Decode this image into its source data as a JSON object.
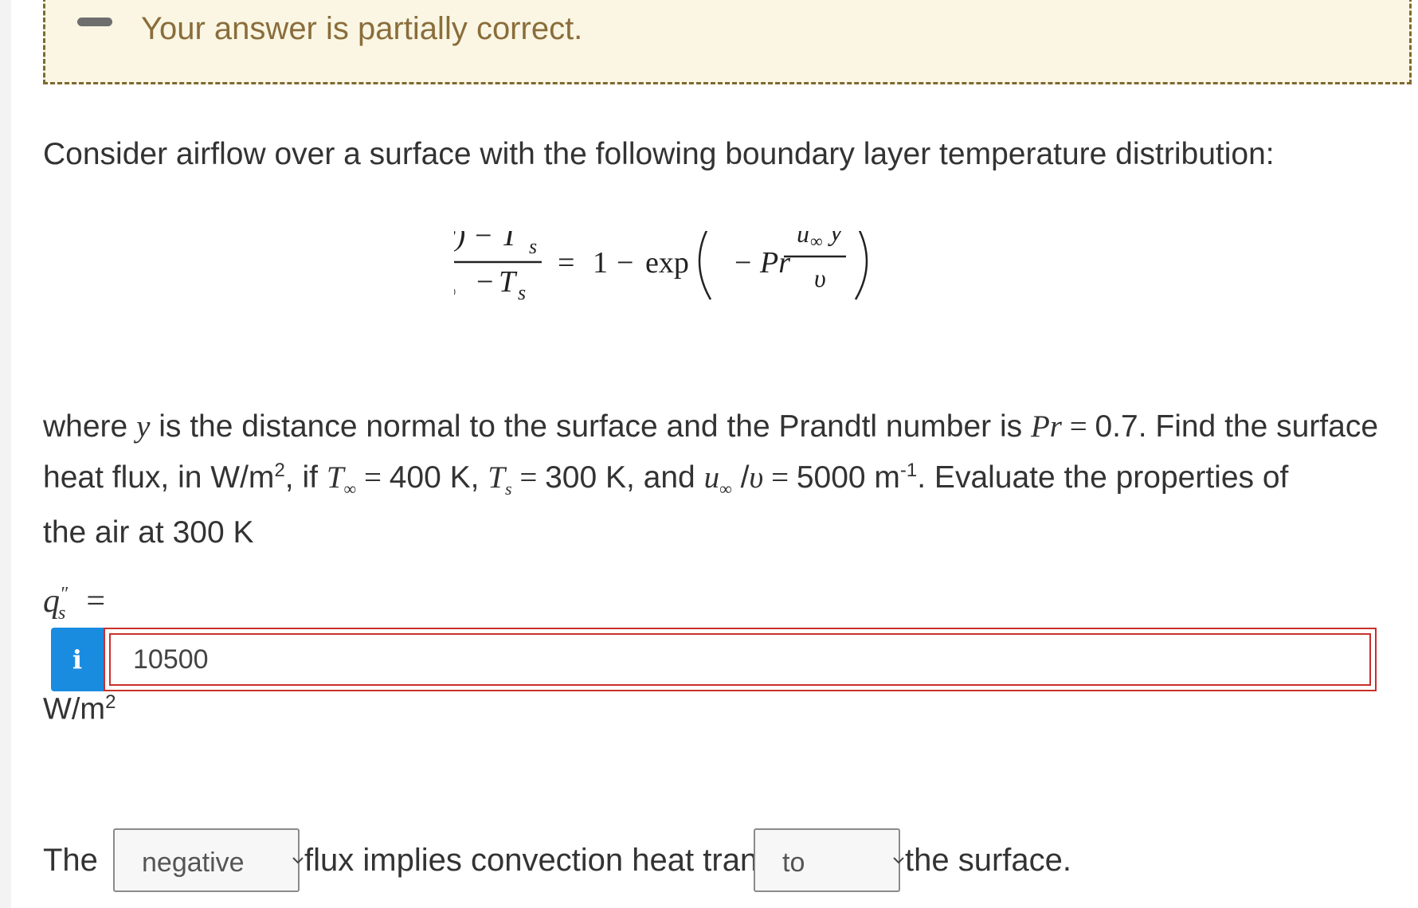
{
  "status": {
    "message": "Your answer is partially correct."
  },
  "question": {
    "intro": "Consider airflow over a surface with the following boundary layer temperature distribution:",
    "equation": {
      "numerator": "T (y) − T",
      "numerator_sub": "s",
      "denominator_a": "T",
      "denominator_a_sub": "∞",
      "denominator_minus": "−",
      "denominator_b": "T",
      "denominator_b_sub": "s",
      "equals": "=",
      "one": "1",
      "minus": "−",
      "exp": "exp",
      "inner_minus": "−",
      "pr": "Pr",
      "frac_num": "u",
      "frac_num_sub": "∞",
      "frac_num_y": "y",
      "frac_den": "υ"
    },
    "line1_a": "where ",
    "line1_y": "y",
    "line1_b": " is the distance normal to the surface and the Prandtl number is ",
    "line1_pr": "Pr",
    "line1_eq": " = ",
    "line1_c": "0.7. Find the surface",
    "line2_a": "heat flux, in W/m",
    "line2_sup": "2",
    "line2_b": ", if ",
    "line2_T": "T",
    "line2_Tsub": "∞",
    "line2_eq1": " = ",
    "line2_c": "400 K, ",
    "line2_Ts": "T",
    "line2_Tssub": "s",
    "line2_eq2": " = ",
    "line2_d": "300 K, and ",
    "line2_u": "u",
    "line2_usub": "∞",
    "line2_slash": " /",
    "line2_nu": "υ",
    "line2_eq3": " = ",
    "line2_e": "5000 m",
    "line2_sup2": "-1",
    "line2_f": ". Evaluate the properties of",
    "line3": "the air at 300 K"
  },
  "answer": {
    "symbol": "q",
    "symbol_sup": "″",
    "symbol_sub": "s",
    "equals": "=",
    "info_label": "i",
    "value": "10500",
    "unit": "W/m",
    "unit_sup": "2"
  },
  "sentence": {
    "word1": "The",
    "select1_value": "negative",
    "word2": "flux implies convection heat transfer",
    "select2_value": "to",
    "word3": "the surface."
  },
  "colors": {
    "banner_bg": "#faf6e3",
    "banner_border": "#7d6a2f",
    "banner_text": "#8a6d3b",
    "info_blue": "#1a8ce0",
    "error_red": "#c9302c"
  }
}
